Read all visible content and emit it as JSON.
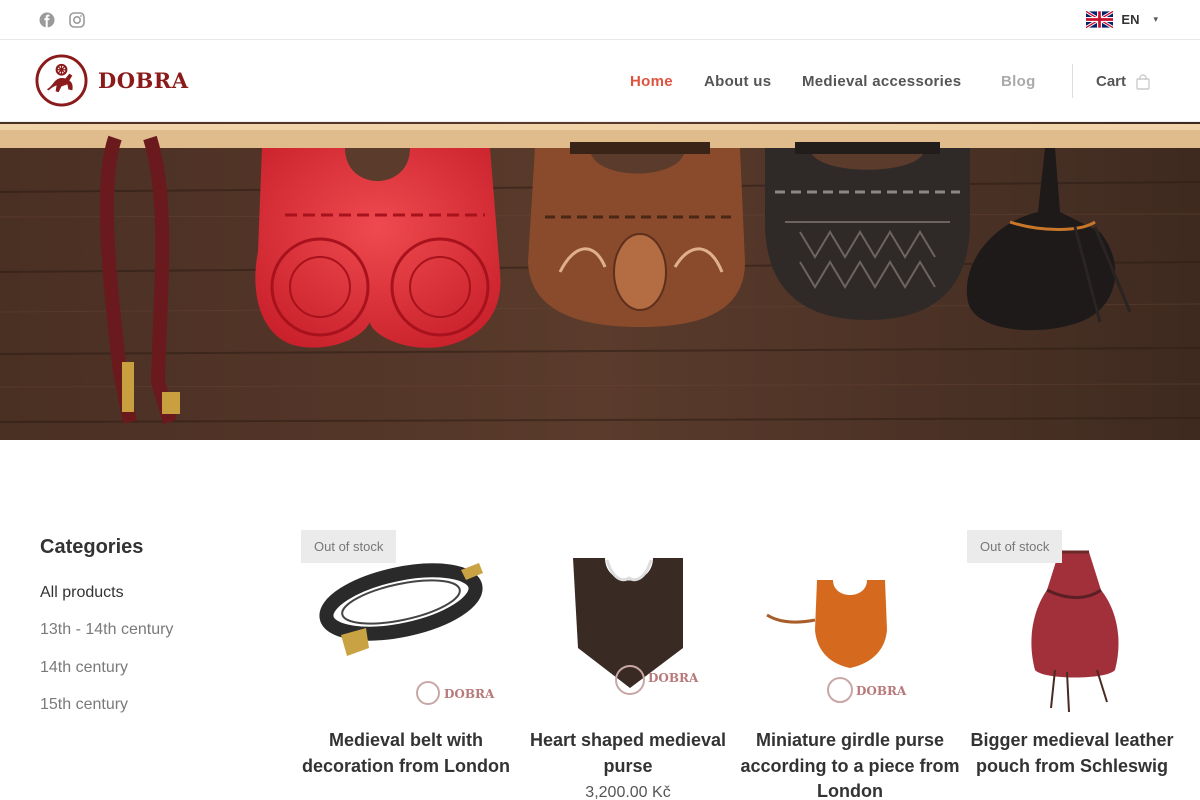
{
  "topbar": {
    "social": [
      "facebook-icon",
      "instagram-icon"
    ],
    "language": "EN"
  },
  "header": {
    "logo_text": "DOBRA",
    "nav": [
      {
        "label": "Home",
        "active": true
      },
      {
        "label": "About us",
        "active": false
      },
      {
        "label": "Medieval accessories",
        "active": false
      },
      {
        "label": "Blog",
        "active": false
      }
    ],
    "cart_label": "Cart",
    "accent_color": "#e0533f"
  },
  "sidebar": {
    "title": "Categories",
    "categories": [
      "All products",
      "13th - 14th century",
      "14th century",
      "15th century"
    ]
  },
  "products": [
    {
      "title": "Medieval belt with decoration from London",
      "badge": "Out of stock",
      "price": ""
    },
    {
      "title": "Heart shaped medieval purse",
      "badge": "",
      "price": "3,200.00 Kč"
    },
    {
      "title": "Miniature girdle purse according to a piece from London",
      "badge": "",
      "price": ""
    },
    {
      "title": "Bigger medieval leather pouch from Schleswig",
      "badge": "Out of stock",
      "price": ""
    }
  ]
}
